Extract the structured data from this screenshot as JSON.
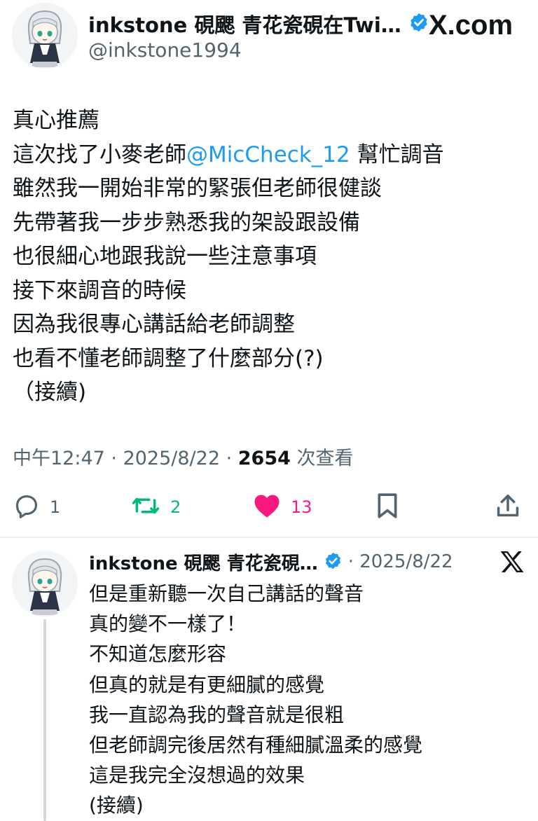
{
  "tweet": {
    "author": {
      "display_name": "inkstone 硯颸 青花瓷硯在Twi…",
      "handle": "@inkstone1994"
    },
    "source_logo": "X.com",
    "lines": [
      "真心推薦",
      "這次找了小麥老師",
      "雖然我一開始非常的緊張但老師很健談",
      "先帶著我一步步熟悉我的架設跟設備",
      "也很細心地跟我說一些注意事項",
      "接下來調音的時候",
      "因為我很專心講話給老師調整",
      "也看不懂老師調整了什麼部分(?)",
      "（接續)"
    ],
    "line2_mention": "@MicCheck_12",
    "line2_tail": " 幫忙調音",
    "time": "中午12:47",
    "separator": " · ",
    "date": "2025/8/22",
    "views_count": "2654",
    "views_label": " 次查看"
  },
  "actions": {
    "reply_count": "1",
    "retweet_count": "2",
    "like_count": "13",
    "icons": [
      "reply-icon",
      "retweet-icon",
      "heart-icon",
      "bookmark-icon",
      "share-icon"
    ],
    "colors": {
      "retweet": "#00ba7c",
      "like": "#f91880",
      "muted": "#536471"
    }
  },
  "reply": {
    "author": {
      "display_name": "inkstone 硯颸 青花瓷硯…"
    },
    "date_prefix": "· ",
    "date": "2025/8/22",
    "lines": [
      "但是重新聽一次自己講話的聲音",
      "真的變不一樣了！",
      "不知道怎麼形容",
      "但真的就是有更細膩的感覺",
      "我一直認為我的聲音就是很粗",
      "但老師調完後居然有種細膩溫柔的感覺",
      "這是我完全沒想過的效果",
      "(接續)"
    ]
  },
  "colors": {
    "link": "#1d9bf0",
    "verified": "#1d9bf0",
    "text": "#0f1419",
    "muted": "#536471"
  }
}
